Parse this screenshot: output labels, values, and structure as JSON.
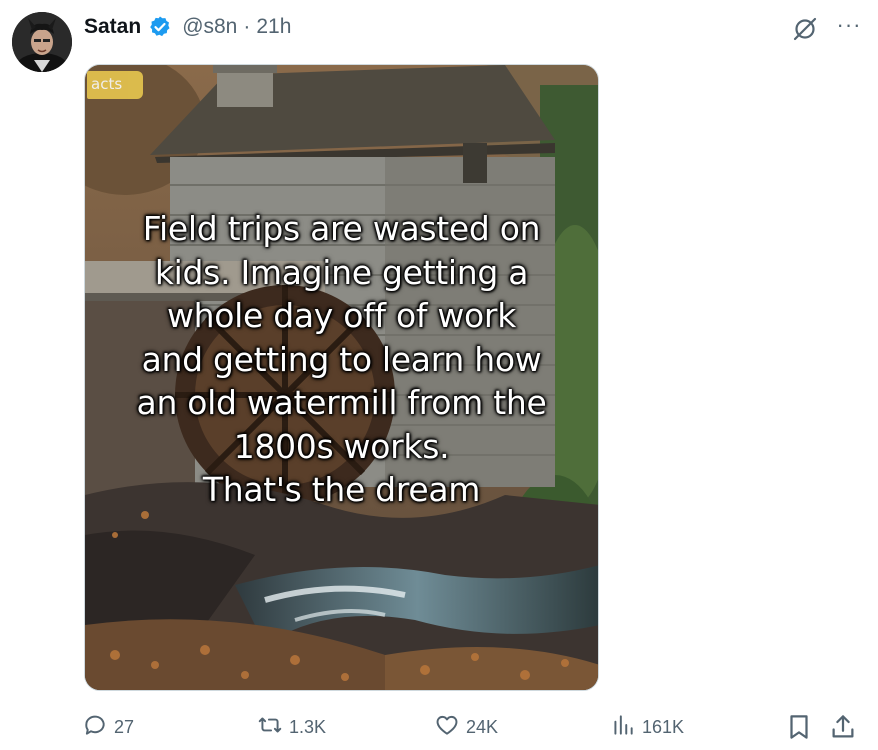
{
  "post": {
    "author_name": "Satan",
    "handle": "@s8n",
    "separator": "·",
    "time": "21h",
    "more_label": "···"
  },
  "media": {
    "watermark": "acts",
    "caption": "Field trips are wasted on\nkids. Imagine getting a\nwhole day off of work\nand getting to learn how\nan old watermill from the\n1800s works.\nThat's the dream"
  },
  "actions": {
    "replies": "27",
    "reposts": "1.3K",
    "likes": "24K",
    "views": "161K"
  },
  "colors": {
    "verified": "#1d9bf0",
    "muted": "#536471",
    "text": "#0f1419"
  },
  "icons": [
    "verified-badge-icon",
    "grok-icon",
    "more-icon",
    "reply-icon",
    "repost-icon",
    "like-icon",
    "views-icon",
    "bookmark-icon",
    "share-icon"
  ]
}
